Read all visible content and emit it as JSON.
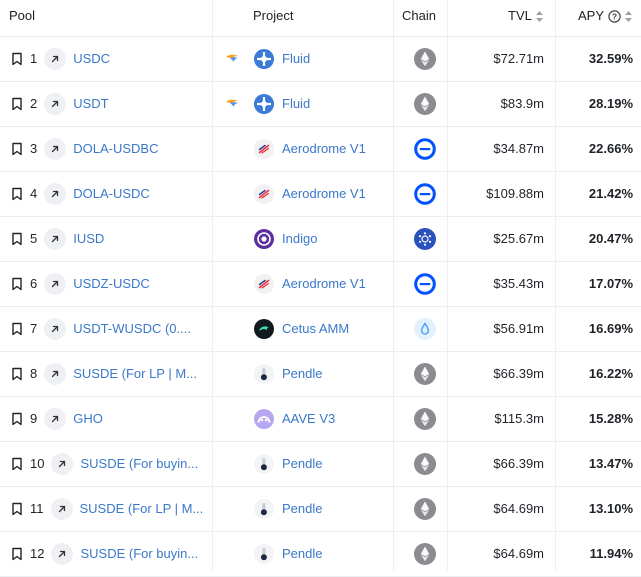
{
  "header": {
    "pool": "Pool",
    "project": "Project",
    "chain": "Chain",
    "tvl": "TVL",
    "apy": "APY"
  },
  "rows": [
    {
      "rank": "1",
      "pool": "USDC",
      "project": "Fluid",
      "project_icon": "fluid-icon",
      "chain_icon": "ethereum-icon",
      "tvl": "$72.71m",
      "apy": "32.59%",
      "lead_icon": "bird-icon"
    },
    {
      "rank": "2",
      "pool": "USDT",
      "project": "Fluid",
      "project_icon": "fluid-icon",
      "chain_icon": "ethereum-icon",
      "tvl": "$83.9m",
      "apy": "28.19%",
      "lead_icon": "bird-icon"
    },
    {
      "rank": "3",
      "pool": "DOLA-USDBC",
      "project": "Aerodrome V1",
      "project_icon": "aerodrome-icon",
      "chain_icon": "base-icon",
      "tvl": "$34.87m",
      "apy": "22.66%"
    },
    {
      "rank": "4",
      "pool": "DOLA-USDC",
      "project": "Aerodrome V1",
      "project_icon": "aerodrome-icon",
      "chain_icon": "base-icon",
      "tvl": "$109.88m",
      "apy": "21.42%"
    },
    {
      "rank": "5",
      "pool": "IUSD",
      "project": "Indigo",
      "project_icon": "indigo-icon",
      "chain_icon": "cardano-icon",
      "tvl": "$25.67m",
      "apy": "20.47%"
    },
    {
      "rank": "6",
      "pool": "USDZ-USDC",
      "project": "Aerodrome V1",
      "project_icon": "aerodrome-icon",
      "chain_icon": "base-icon",
      "tvl": "$35.43m",
      "apy": "17.07%"
    },
    {
      "rank": "7",
      "pool": "USDT-WUSDC (0....",
      "project": "Cetus AMM",
      "project_icon": "cetus-icon",
      "chain_icon": "sui-icon",
      "tvl": "$56.91m",
      "apy": "16.69%"
    },
    {
      "rank": "8",
      "pool": "SUSDE (For LP | M...",
      "project": "Pendle",
      "project_icon": "pendle-icon",
      "chain_icon": "ethereum-icon",
      "tvl": "$66.39m",
      "apy": "16.22%"
    },
    {
      "rank": "9",
      "pool": "GHO",
      "project": "AAVE V3",
      "project_icon": "aave-icon",
      "chain_icon": "ethereum-icon",
      "tvl": "$115.3m",
      "apy": "15.28%"
    },
    {
      "rank": "10",
      "pool": "SUSDE (For buyin...",
      "project": "Pendle",
      "project_icon": "pendle-icon",
      "chain_icon": "ethereum-icon",
      "tvl": "$66.39m",
      "apy": "13.47%"
    },
    {
      "rank": "11",
      "pool": "SUSDE (For LP | M...",
      "project": "Pendle",
      "project_icon": "pendle-icon",
      "chain_icon": "ethereum-icon",
      "tvl": "$64.69m",
      "apy": "13.10%"
    },
    {
      "rank": "12",
      "pool": "SUSDE (For buyin...",
      "project": "Pendle",
      "project_icon": "pendle-icon",
      "chain_icon": "ethereum-icon",
      "tvl": "$64.69m",
      "apy": "11.94%"
    }
  ],
  "colors": {
    "link": "#3b78c9",
    "base_blue": "#0052ff",
    "cardano_blue": "#2a52be",
    "border": "#eceef0"
  }
}
